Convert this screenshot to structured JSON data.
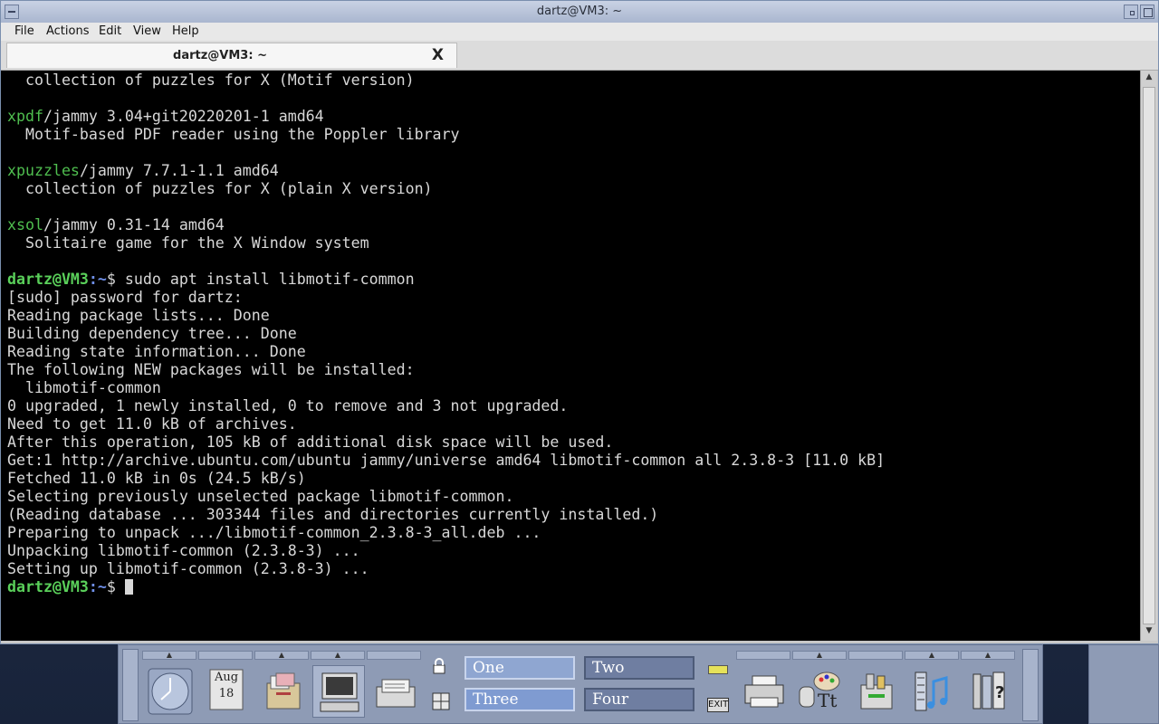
{
  "window": {
    "title": "dartz@VM3: ~",
    "menu": [
      "File",
      "Actions",
      "Edit",
      "View",
      "Help"
    ],
    "tab_label": "dartz@VM3: ~",
    "tab_close": "X"
  },
  "terminal": {
    "prompt_user": "dartz@VM3",
    "prompt_path": ":~",
    "prompt_sym": "$",
    "lines": [
      {
        "type": "text",
        "text": "  collection of puzzles for X (Motif version)"
      },
      {
        "type": "blank"
      },
      {
        "type": "pkg",
        "name": "xpdf",
        "rest": "/jammy 3.04+git20220201-1 amd64"
      },
      {
        "type": "text",
        "text": "  Motif-based PDF reader using the Poppler library"
      },
      {
        "type": "blank"
      },
      {
        "type": "pkg",
        "name": "xpuzzles",
        "rest": "/jammy 7.7.1-1.1 amd64"
      },
      {
        "type": "text",
        "text": "  collection of puzzles for X (plain X version)"
      },
      {
        "type": "blank"
      },
      {
        "type": "pkg",
        "name": "xsol",
        "rest": "/jammy 0.31-14 amd64"
      },
      {
        "type": "text",
        "text": "  Solitaire game for the X Window system"
      },
      {
        "type": "blank"
      },
      {
        "type": "prompt",
        "cmd": " sudo apt install libmotif-common"
      },
      {
        "type": "text",
        "text": "[sudo] password for dartz:"
      },
      {
        "type": "text",
        "text": "Reading package lists... Done"
      },
      {
        "type": "text",
        "text": "Building dependency tree... Done"
      },
      {
        "type": "text",
        "text": "Reading state information... Done"
      },
      {
        "type": "text",
        "text": "The following NEW packages will be installed:"
      },
      {
        "type": "text",
        "text": "  libmotif-common"
      },
      {
        "type": "text",
        "text": "0 upgraded, 1 newly installed, 0 to remove and 3 not upgraded."
      },
      {
        "type": "text",
        "text": "Need to get 11.0 kB of archives."
      },
      {
        "type": "text",
        "text": "After this operation, 105 kB of additional disk space will be used."
      },
      {
        "type": "text",
        "text": "Get:1 http://archive.ubuntu.com/ubuntu jammy/universe amd64 libmotif-common all 2.3.8-3 [11.0 kB]"
      },
      {
        "type": "text",
        "text": "Fetched 11.0 kB in 0s (24.5 kB/s)"
      },
      {
        "type": "text",
        "text": "Selecting previously unselected package libmotif-common."
      },
      {
        "type": "text",
        "text": "(Reading database ... 303344 files and directories currently installed.)"
      },
      {
        "type": "text",
        "text": "Preparing to unpack .../libmotif-common_2.3.8-3_all.deb ..."
      },
      {
        "type": "text",
        "text": "Unpacking libmotif-common (2.3.8-3) ..."
      },
      {
        "type": "text",
        "text": "Setting up libmotif-common (2.3.8-3) ..."
      },
      {
        "type": "prompt",
        "cmd": " ",
        "cursor": true
      }
    ]
  },
  "panel": {
    "calendar_month": "Aug",
    "calendar_day": "18",
    "workspaces": [
      "One",
      "Two",
      "Three",
      "Four"
    ],
    "active_workspace": "Three",
    "exit_label": "EXIT"
  },
  "colors": {
    "pkg_name": "#4fbe4f",
    "prompt_user": "#5ad05a",
    "prompt_path": "#6f8fe8",
    "panel_bg": "#8e9bb5"
  }
}
